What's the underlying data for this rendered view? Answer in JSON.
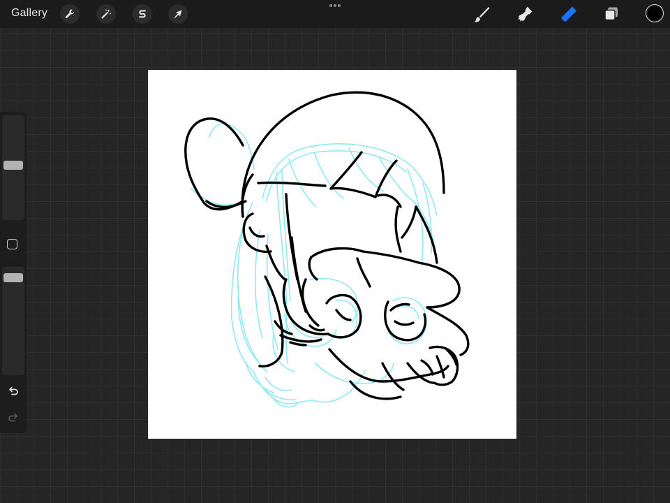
{
  "topbar": {
    "gallery_label": "Gallery",
    "actions_icon": "wrench-icon",
    "adjustments_icon": "magic-wand-icon",
    "selection_icon": "selection-s-icon",
    "transform_icon": "arrow-cursor-icon",
    "more_icon": "three-dots-icon"
  },
  "right_tools": {
    "brush_icon": "brush-icon",
    "smudge_icon": "smudge-icon",
    "eraser_icon": "eraser-icon",
    "eraser_active_color": "#1a74ff",
    "layers_icon": "layers-icon",
    "current_color": "#000000"
  },
  "sidebar": {
    "brush_size_level": 0.53,
    "opacity_level": 0.95,
    "modify_icon": "square-icon",
    "undo_icon": "undo-icon",
    "redo_icon": "redo-icon"
  },
  "canvas": {
    "background": "#ffffff",
    "lineart_color": "#000000",
    "sketch_color": "#8fe9f5"
  }
}
